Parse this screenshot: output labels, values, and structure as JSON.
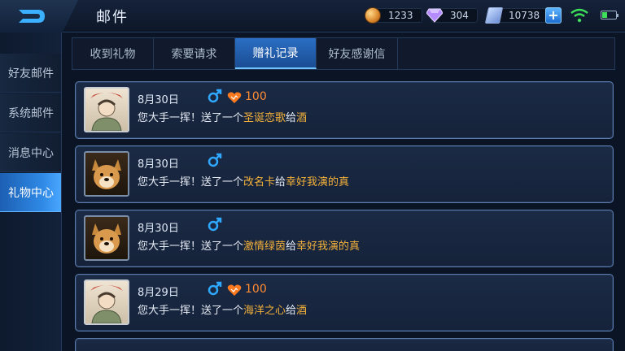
{
  "header": {
    "title": "邮件",
    "gold": "1233",
    "diamond": "304",
    "voucher": "10738"
  },
  "sidebar": {
    "items": [
      {
        "label": "好友邮件",
        "active": false
      },
      {
        "label": "系统邮件",
        "active": false
      },
      {
        "label": "消息中心",
        "active": false
      },
      {
        "label": "礼物中心",
        "active": true
      }
    ]
  },
  "tabs": [
    {
      "label": "收到礼物",
      "active": false
    },
    {
      "label": "索要请求",
      "active": false
    },
    {
      "label": "赠礼记录",
      "active": true
    },
    {
      "label": "好友感谢信",
      "active": false
    }
  ],
  "records": [
    {
      "avatar": "human",
      "date": "8月30日",
      "gender": "male",
      "charm": "100",
      "prefix": "您大手一挥！送了一个",
      "gift": "圣诞恋歌",
      "mid": "给",
      "recipient": "酒"
    },
    {
      "avatar": "dog",
      "date": "8月30日",
      "gender": "male",
      "charm": "",
      "prefix": "您大手一挥！送了一个",
      "gift": "改名卡",
      "mid": "给",
      "recipient": "幸好我演的真"
    },
    {
      "avatar": "dog",
      "date": "8月30日",
      "gender": "male",
      "charm": "",
      "prefix": "您大手一挥！送了一个",
      "gift": "激情绿茵",
      "mid": "给",
      "recipient": "幸好我演的真"
    },
    {
      "avatar": "human",
      "date": "8月29日",
      "gender": "male",
      "charm": "100",
      "prefix": "您大手一挥！送了一个",
      "gift": "海洋之心",
      "mid": "给",
      "recipient": "酒"
    }
  ],
  "colors": {
    "accent": "#2f8ae6",
    "highlight": "#f5b23a",
    "charm": "#ff8c33",
    "male": "#2fa8ff"
  }
}
